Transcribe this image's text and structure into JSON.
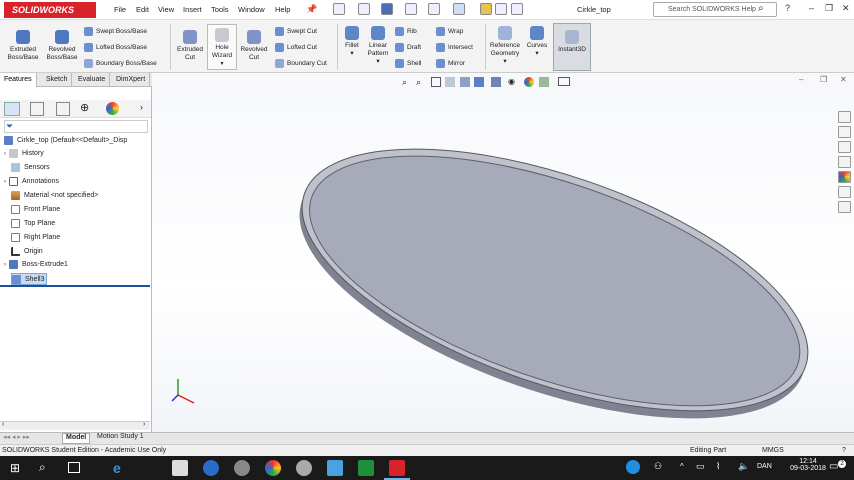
{
  "app": {
    "logo": "SOLIDWORKS",
    "doc_title": "Cirkle_top"
  },
  "menu": [
    "File",
    "Edit",
    "View",
    "Insert",
    "Tools",
    "Window",
    "Help"
  ],
  "search": {
    "placeholder": "Search SOLIDWORKS Help"
  },
  "ribbon": {
    "extruded_boss": "Extruded Boss/Base",
    "revolved_boss": "Revolved Boss/Base",
    "swept_boss": "Swept Boss/Base",
    "lofted_boss": "Lofted Boss/Base",
    "boundary_boss": "Boundary Boss/Base",
    "extruded_cut": "Extruded Cut",
    "hole_wizard": "Hole Wizard",
    "revolved_cut": "Revolved Cut",
    "swept_cut": "Swept Cut",
    "lofted_cut": "Lofted Cut",
    "boundary_cut": "Boundary Cut",
    "fillet": "Fillet",
    "linear_pattern": "Linear Pattern",
    "rib": "Rib",
    "draft": "Draft",
    "shell": "Shell",
    "wrap": "Wrap",
    "intersect": "Intersect",
    "mirror": "Mirror",
    "reference_geometry": "Reference Geometry",
    "curves": "Curves",
    "instant3d": "Instant3D"
  },
  "tabs": [
    "Features",
    "Sketch",
    "Evaluate",
    "DimXpert"
  ],
  "tree": {
    "root": "Cirkle_top  (Default<<Default>_Disp",
    "items": [
      "History",
      "Sensors",
      "Annotations",
      "Material <not specified>",
      "Front Plane",
      "Top Plane",
      "Right Plane",
      "Origin",
      "Boss-Extrude1",
      "Shell3"
    ]
  },
  "bottom_tabs": [
    "Model",
    "Motion Study 1"
  ],
  "status": {
    "left": "SOLIDWORKS Student Edition - Academic Use Only",
    "mode": "Editing Part",
    "units": "MMGS"
  },
  "taskbar": {
    "lang": "DAN",
    "time": "12:14",
    "date": "09-03-2018",
    "notif": "2"
  },
  "colors": {
    "brand_red": "#d8232a",
    "part_face": "#a7aab8",
    "selection": "#c7dcf2"
  }
}
